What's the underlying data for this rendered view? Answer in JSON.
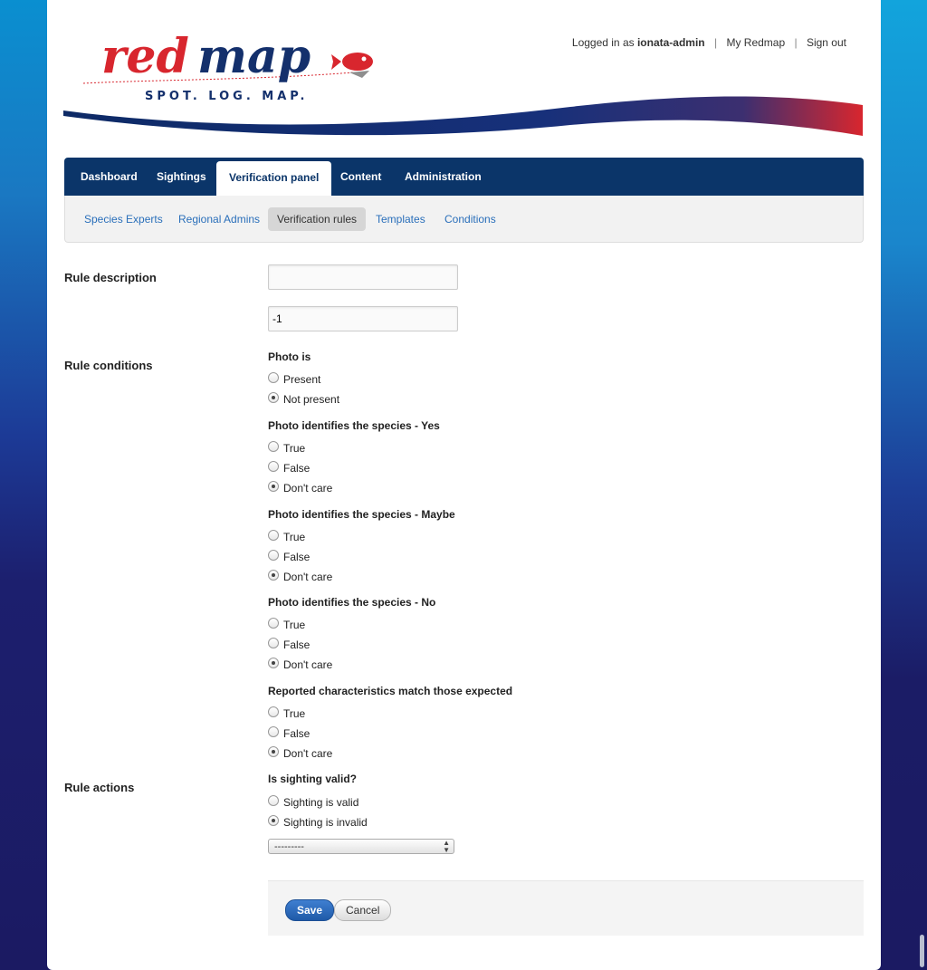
{
  "header": {
    "logo_text": "redmap",
    "tagline": "SPOT. LOG. MAP.",
    "logged_in_prefix": "Logged in as",
    "username": "ionata-admin",
    "my_redmap": "My Redmap",
    "sign_out": "Sign out"
  },
  "main_nav": {
    "tabs": [
      {
        "label": "Dashboard"
      },
      {
        "label": "Sightings"
      },
      {
        "label": "Verification panel",
        "active": true
      },
      {
        "label": "Content"
      },
      {
        "label": "Administration"
      }
    ]
  },
  "sub_nav": {
    "items": [
      {
        "label": "Species Experts"
      },
      {
        "label": "Regional Admins"
      },
      {
        "label": "Verification rules",
        "active": true
      },
      {
        "label": "Templates"
      },
      {
        "label": "Conditions"
      }
    ]
  },
  "form": {
    "rule_description_label": "Rule description",
    "description_value": "",
    "weight_value": "-1",
    "rule_conditions_label": "Rule conditions",
    "groups": [
      {
        "title": "Photo is",
        "options": [
          {
            "label": "Present",
            "checked": false
          },
          {
            "label": "Not present",
            "checked": true
          }
        ]
      },
      {
        "title": "Photo identifies the species - Yes",
        "options": [
          {
            "label": "True",
            "checked": false
          },
          {
            "label": "False",
            "checked": false
          },
          {
            "label": "Don't care",
            "checked": true
          }
        ]
      },
      {
        "title": "Photo identifies the species - Maybe",
        "options": [
          {
            "label": "True",
            "checked": false
          },
          {
            "label": "False",
            "checked": false
          },
          {
            "label": "Don't care",
            "checked": true
          }
        ]
      },
      {
        "title": "Photo identifies the species - No",
        "options": [
          {
            "label": "True",
            "checked": false
          },
          {
            "label": "False",
            "checked": false
          },
          {
            "label": "Don't care",
            "checked": true
          }
        ]
      },
      {
        "title": "Reported characteristics match those expected",
        "options": [
          {
            "label": "True",
            "checked": false
          },
          {
            "label": "False",
            "checked": false
          },
          {
            "label": "Don't care",
            "checked": true
          }
        ]
      }
    ],
    "rule_actions_label": "Rule actions",
    "valid_group": {
      "title": "Is sighting valid?",
      "options": [
        {
          "label": "Sighting is valid",
          "checked": false
        },
        {
          "label": "Sighting is invalid",
          "checked": true
        }
      ]
    },
    "select_value": "---------",
    "save_label": "Save",
    "cancel_label": "Cancel"
  },
  "colors": {
    "nav_bg": "#0b3569",
    "link": "#2a6fba",
    "logo_red": "#d8262e",
    "logo_navy": "#14306c"
  }
}
